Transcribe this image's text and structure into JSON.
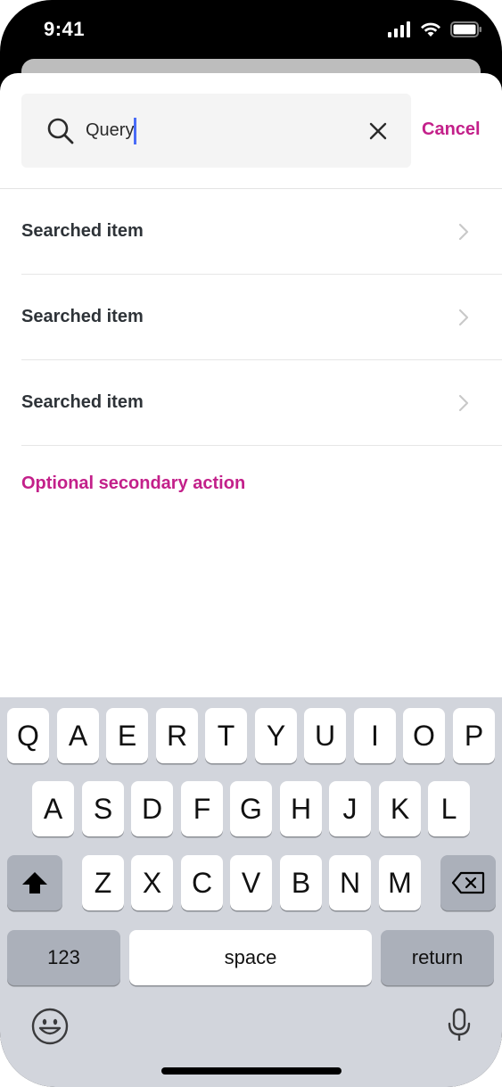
{
  "status_bar": {
    "time": "9:41"
  },
  "search": {
    "query": "Query",
    "cancel_label": "Cancel"
  },
  "results": [
    {
      "label": "Searched item"
    },
    {
      "label": "Searched item"
    },
    {
      "label": "Searched item"
    }
  ],
  "secondary_action": "Optional secondary action",
  "colors": {
    "accent": "#c3208a",
    "caret": "#4a6cf7",
    "keyboard_bg": "#d2d5dc"
  },
  "keyboard": {
    "row1": [
      "Q",
      "A",
      "E",
      "R",
      "T",
      "Y",
      "U",
      "I",
      "O",
      "P"
    ],
    "row2": [
      "A",
      "S",
      "D",
      "F",
      "G",
      "H",
      "J",
      "K",
      "L"
    ],
    "row3": [
      "Z",
      "X",
      "C",
      "V",
      "B",
      "N",
      "M"
    ],
    "numbers_label": "123",
    "space_label": "space",
    "return_label": "return",
    "icons": [
      "shift-icon",
      "backspace-icon",
      "emoji-icon",
      "microphone-icon"
    ]
  }
}
